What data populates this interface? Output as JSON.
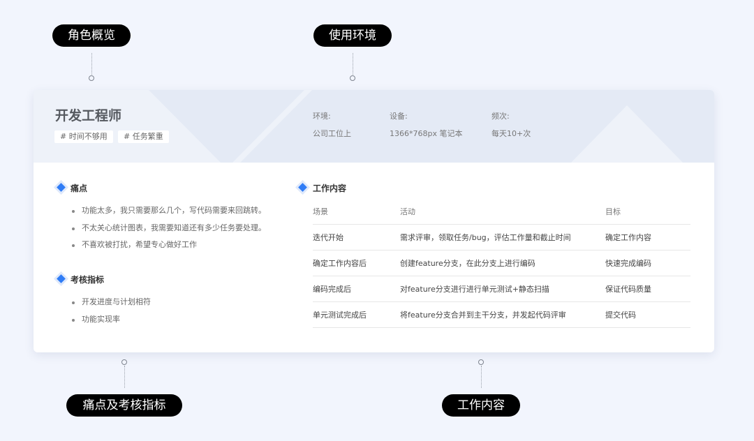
{
  "callouts": {
    "role_overview": "角色概览",
    "environment": "使用环境",
    "pain_and_metrics": "痛点及考核指标",
    "work_content": "工作内容"
  },
  "role": {
    "title": "开发工程师",
    "tags": [
      "# 时间不够用",
      "# 任务繁重"
    ]
  },
  "environment": {
    "env_label": "环境:",
    "env_value": "公司工位上",
    "device_label": "设备:",
    "device_value": "1366*768px 笔记本",
    "frequency_label": "频次:",
    "frequency_value": "每天10+次"
  },
  "pain_points": {
    "title": "痛点",
    "items": [
      "功能太多，我只需要那么几个，写代码需要来回跳转。",
      "不太关心统计图表，我需要知道还有多少任务要处理。",
      "不喜欢被打扰，希望专心做好工作"
    ]
  },
  "metrics": {
    "title": "考核指标",
    "items": [
      "开发进度与计划相符",
      "功能实现率"
    ]
  },
  "work": {
    "title": "工作内容",
    "headers": [
      "场景",
      "活动",
      "目标"
    ],
    "rows": [
      [
        "迭代开始",
        "需求评审，领取任务/bug，评估工作量和截止时间",
        "确定工作内容"
      ],
      [
        "确定工作内容后",
        "创建feature分支，在此分支上进行编码",
        "快速完成编码"
      ],
      [
        "编码完成后",
        "对feature分支进行进行单元测试+静态扫描",
        "保证代码质量"
      ],
      [
        "单元测试完成后",
        "将feature分支合并到主干分支，并发起代码评审",
        "提交代码"
      ]
    ]
  },
  "colors": {
    "page_background": "#f2f5fd",
    "header_band": "#e4eaf5",
    "accent": "#2f7cf6",
    "pill": "#000000"
  }
}
